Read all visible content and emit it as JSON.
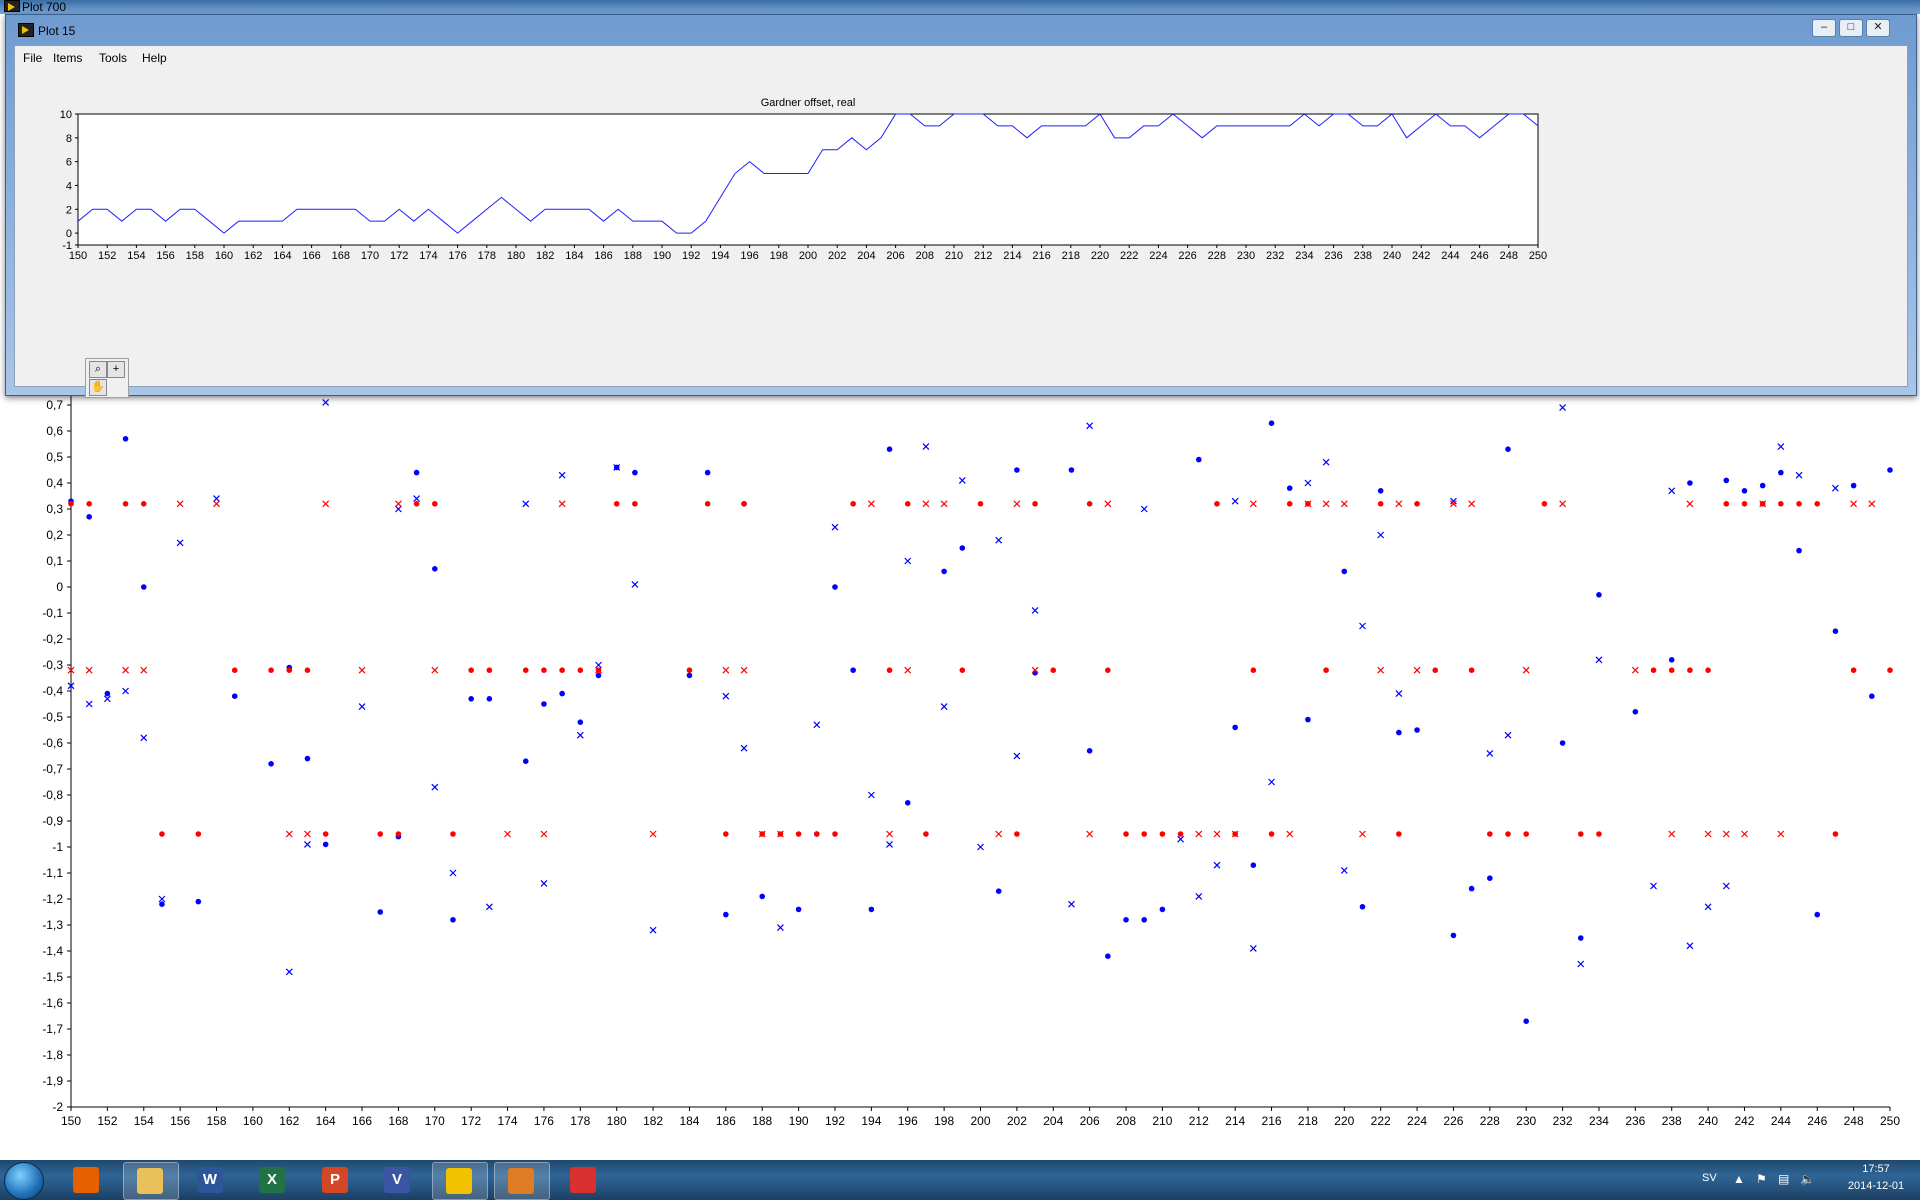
{
  "background_window": {
    "title": "Plot 700"
  },
  "foreground_window": {
    "title": "Plot 15",
    "menu": [
      "File",
      "Items",
      "Tools",
      "Help"
    ],
    "controls": [
      "minimize",
      "maximize",
      "close"
    ]
  },
  "colors": {
    "line": "#1f1fff",
    "blue_series": "#0000ff",
    "red_series": "#ff0000",
    "window_bg": "#f0f0f0",
    "taskbar": "#2f6596"
  },
  "chart_data": [
    {
      "type": "line",
      "title": "Gardner offset, real",
      "xlim": [
        150,
        250
      ],
      "ylim": [
        -1,
        10
      ],
      "xticks": [
        150,
        152,
        154,
        156,
        158,
        160,
        162,
        164,
        166,
        168,
        170,
        172,
        174,
        176,
        178,
        180,
        182,
        184,
        186,
        188,
        190,
        192,
        194,
        196,
        198,
        200,
        202,
        204,
        206,
        208,
        210,
        212,
        214,
        216,
        218,
        220,
        222,
        224,
        226,
        228,
        230,
        232,
        234,
        236,
        238,
        240,
        242,
        244,
        246,
        248,
        250
      ],
      "yticks": [
        -1,
        0,
        2,
        4,
        6,
        8,
        10
      ],
      "grid": false,
      "x": [
        150,
        151,
        152,
        153,
        154,
        155,
        156,
        157,
        158,
        159,
        160,
        161,
        162,
        163,
        164,
        165,
        166,
        167,
        168,
        169,
        170,
        171,
        172,
        173,
        174,
        175,
        176,
        177,
        178,
        179,
        180,
        181,
        182,
        183,
        184,
        185,
        186,
        187,
        188,
        189,
        190,
        191,
        192,
        193,
        194,
        195,
        196,
        197,
        198,
        199,
        200,
        201,
        202,
        203,
        204,
        205,
        206,
        207,
        208,
        209,
        210,
        211,
        212,
        213,
        214,
        215,
        216,
        217,
        218,
        219,
        220,
        221,
        222,
        223,
        224,
        225,
        226,
        227,
        228,
        229,
        230,
        231,
        232,
        233,
        234,
        235,
        236,
        237,
        238,
        239,
        240,
        241,
        242,
        243,
        244,
        245,
        246,
        247,
        248,
        249,
        250
      ],
      "y": [
        1,
        2,
        2,
        1,
        2,
        2,
        1,
        2,
        2,
        1,
        0,
        1,
        1,
        1,
        1,
        2,
        2,
        2,
        2,
        2,
        1,
        1,
        2,
        1,
        2,
        1,
        0,
        1,
        2,
        3,
        2,
        1,
        2,
        2,
        2,
        2,
        1,
        2,
        1,
        1,
        1,
        0,
        0,
        1,
        3,
        5,
        6,
        5,
        5,
        5,
        5,
        7,
        7,
        8,
        7,
        8,
        10,
        10,
        9,
        9,
        10,
        10,
        10,
        9,
        9,
        8,
        9,
        9,
        9,
        9,
        10,
        8,
        8,
        9,
        9,
        10,
        9,
        8,
        9,
        9,
        9,
        9,
        9,
        9,
        10,
        9,
        10,
        10,
        9,
        9,
        10,
        8,
        9,
        10,
        9,
        9,
        8,
        9,
        10,
        10,
        9
      ]
    },
    {
      "type": "scatter",
      "title": "",
      "xlim": [
        150,
        250
      ],
      "ylim": [
        -2,
        0.7
      ],
      "xticks": [
        150,
        152,
        154,
        156,
        158,
        160,
        162,
        164,
        166,
        168,
        170,
        172,
        174,
        176,
        178,
        180,
        182,
        184,
        186,
        188,
        190,
        192,
        194,
        196,
        198,
        200,
        202,
        204,
        206,
        208,
        210,
        212,
        214,
        216,
        218,
        220,
        222,
        224,
        226,
        228,
        230,
        232,
        234,
        236,
        238,
        240,
        242,
        244,
        246,
        248,
        250
      ],
      "yticks": [
        "0,7",
        "0,6",
        "0,5",
        "0,4",
        "0,3",
        "0,2",
        "0,1",
        "0",
        "-0,1",
        "-0,2",
        "-0,3",
        "-0,4",
        "-0,5",
        "-0,6",
        "-0,7",
        "-0,8",
        "-0,9",
        "-1",
        "-1,1",
        "-1,2",
        "-1,3",
        "-1,4",
        "-1,5",
        "-1,6",
        "-1,7",
        "-1,8",
        "-1,9",
        "-2"
      ],
      "grid": false,
      "series": [
        {
          "marker": "dot",
          "color": "#0000ff",
          "x": [
            150,
            151,
            152,
            153,
            154,
            155,
            157,
            159,
            161,
            162,
            163,
            164,
            167,
            168,
            169,
            170,
            171,
            172,
            173,
            175,
            176,
            177,
            178,
            179,
            180,
            181,
            184,
            185,
            186,
            187,
            188,
            190,
            191,
            192,
            193,
            194,
            195,
            196,
            198,
            199,
            201,
            202,
            203,
            205,
            206,
            207,
            208,
            209,
            210,
            212,
            214,
            215,
            216,
            217,
            218,
            220,
            221,
            222,
            223,
            224,
            226,
            227,
            228,
            229,
            230,
            232,
            233,
            234,
            236,
            238,
            239,
            241,
            242,
            243,
            244,
            245,
            246,
            247,
            248,
            249,
            250
          ],
          "y": [
            0.33,
            0.27,
            -0.41,
            0.57,
            0.0,
            -1.22,
            -1.21,
            -0.42,
            -0.68,
            -0.31,
            -0.66,
            -0.99,
            -1.25,
            -0.96,
            0.44,
            0.07,
            -1.28,
            -0.43,
            -0.43,
            -0.67,
            -0.45,
            -0.41,
            -0.52,
            -0.34,
            0.46,
            0.44,
            -0.34,
            0.44,
            -1.26,
            0.32,
            -1.19,
            -1.24,
            -0.95,
            0.0,
            -0.32,
            -1.24,
            0.53,
            -0.83,
            0.06,
            0.15,
            -1.17,
            0.45,
            -0.33,
            0.45,
            -0.63,
            -1.42,
            -1.28,
            -1.28,
            -1.24,
            0.49,
            -0.54,
            -1.07,
            0.63,
            0.38,
            -0.51,
            0.06,
            -1.23,
            0.37,
            -0.56,
            -0.55,
            -1.34,
            -1.16,
            -1.12,
            0.53,
            -1.67,
            -0.6,
            -1.35,
            -0.03,
            -0.48,
            -0.28,
            0.4,
            0.41,
            0.37,
            0.39,
            0.44,
            0.14,
            -1.26,
            -0.17,
            0.39,
            -0.42,
            0.45
          ]
        },
        {
          "marker": "x",
          "color": "#0000ff",
          "x": [
            150,
            151,
            152,
            153,
            154,
            155,
            156,
            158,
            162,
            163,
            164,
            166,
            168,
            169,
            170,
            171,
            173,
            175,
            176,
            177,
            178,
            179,
            180,
            181,
            182,
            186,
            187,
            189,
            191,
            192,
            194,
            195,
            196,
            197,
            198,
            199,
            200,
            201,
            202,
            203,
            205,
            206,
            209,
            211,
            212,
            213,
            214,
            215,
            216,
            218,
            219,
            220,
            221,
            222,
            223,
            226,
            228,
            229,
            232,
            233,
            234,
            237,
            238,
            239,
            240,
            241,
            244,
            245,
            247
          ],
          "y": [
            -0.38,
            -0.45,
            -0.43,
            -0.4,
            -0.58,
            -1.2,
            0.17,
            0.34,
            -1.48,
            -0.99,
            0.71,
            -0.46,
            0.3,
            0.34,
            -0.77,
            -1.1,
            -1.23,
            0.32,
            -1.14,
            0.43,
            -0.57,
            -0.3,
            0.46,
            0.01,
            -1.32,
            -0.42,
            -0.62,
            -1.31,
            -0.53,
            0.23,
            -0.8,
            -0.99,
            0.1,
            0.54,
            -0.46,
            0.41,
            -1.0,
            0.18,
            -0.65,
            -0.09,
            -1.22,
            0.62,
            0.3,
            -0.97,
            -1.19,
            -1.07,
            0.33,
            -1.39,
            -0.75,
            0.4,
            0.48,
            -1.09,
            -0.15,
            0.2,
            -0.41,
            0.33,
            -0.64,
            -0.57,
            0.69,
            -1.45,
            -0.28,
            -1.15,
            0.37,
            -1.38,
            -1.23,
            -1.15,
            0.54,
            0.43,
            0.38
          ]
        },
        {
          "marker": "dot",
          "color": "#ff0000",
          "x": [
            150,
            151,
            153,
            154,
            155,
            157,
            159,
            161,
            162,
            163,
            164,
            167,
            168,
            169,
            170,
            171,
            172,
            173,
            175,
            176,
            177,
            178,
            179,
            180,
            181,
            184,
            185,
            186,
            187,
            188,
            189,
            190,
            191,
            192,
            193,
            195,
            196,
            197,
            199,
            200,
            202,
            203,
            204,
            206,
            207,
            208,
            209,
            210,
            211,
            213,
            214,
            215,
            216,
            217,
            218,
            219,
            222,
            223,
            224,
            225,
            227,
            228,
            229,
            230,
            231,
            233,
            234,
            237,
            238,
            239,
            240,
            241,
            242,
            243,
            244,
            245,
            246,
            247,
            248,
            250
          ],
          "y": [
            0.32,
            0.32,
            0.32,
            0.32,
            -0.95,
            -0.95,
            -0.32,
            -0.32,
            -0.32,
            -0.32,
            -0.95,
            -0.95,
            -0.95,
            0.32,
            0.32,
            -0.95,
            -0.32,
            -0.32,
            -0.32,
            -0.32,
            -0.32,
            -0.32,
            -0.32,
            0.32,
            0.32,
            -0.32,
            0.32,
            -0.95,
            0.32,
            -0.95,
            -0.95,
            -0.95,
            -0.95,
            -0.95,
            0.32,
            -0.32,
            0.32,
            -0.95,
            -0.32,
            0.32,
            -0.95,
            0.32,
            -0.32,
            0.32,
            -0.32,
            -0.95,
            -0.95,
            -0.95,
            -0.95,
            0.32,
            -0.95,
            -0.32,
            -0.95,
            0.32,
            0.32,
            -0.32,
            0.32,
            -0.95,
            0.32,
            -0.32,
            -0.32,
            -0.95,
            -0.95,
            -0.95,
            0.32,
            -0.95,
            -0.95,
            -0.32,
            -0.32,
            -0.32,
            -0.32,
            0.32,
            0.32,
            0.32,
            0.32,
            0.32,
            0.32,
            -0.95,
            -0.32,
            -0.32
          ]
        },
        {
          "marker": "x",
          "color": "#ff0000",
          "x": [
            150,
            151,
            153,
            154,
            156,
            158,
            162,
            163,
            164,
            166,
            168,
            170,
            174,
            176,
            177,
            179,
            182,
            186,
            187,
            188,
            189,
            194,
            195,
            196,
            197,
            198,
            201,
            202,
            203,
            206,
            207,
            212,
            213,
            214,
            215,
            217,
            218,
            219,
            220,
            221,
            222,
            223,
            224,
            226,
            227,
            230,
            232,
            236,
            238,
            239,
            240,
            241,
            242,
            243,
            244,
            248,
            249
          ],
          "y": [
            -0.32,
            -0.32,
            -0.32,
            -0.32,
            0.32,
            0.32,
            -0.95,
            -0.95,
            0.32,
            -0.32,
            0.32,
            -0.32,
            -0.95,
            -0.95,
            0.32,
            -0.32,
            -0.95,
            -0.32,
            -0.32,
            -0.95,
            -0.95,
            0.32,
            -0.95,
            -0.32,
            0.32,
            0.32,
            -0.95,
            0.32,
            -0.32,
            -0.95,
            0.32,
            -0.95,
            -0.95,
            -0.95,
            0.32,
            -0.95,
            0.32,
            0.32,
            0.32,
            -0.95,
            -0.32,
            0.32,
            -0.32,
            0.32,
            0.32,
            -0.32,
            0.32,
            -0.32,
            -0.95,
            0.32,
            -0.95,
            -0.95,
            -0.95,
            0.32,
            -0.95,
            0.32,
            0.32
          ]
        }
      ]
    }
  ],
  "taskbar": {
    "items": [
      {
        "name": "firefox",
        "glyph": "",
        "color": "#e66000"
      },
      {
        "name": "windows-explorer",
        "glyph": "",
        "color": "#e8c15a"
      },
      {
        "name": "word",
        "glyph": "W",
        "color": "#2b579a"
      },
      {
        "name": "excel",
        "glyph": "X",
        "color": "#217346"
      },
      {
        "name": "powerpoint",
        "glyph": "P",
        "color": "#d24726"
      },
      {
        "name": "visio",
        "glyph": "V",
        "color": "#3955a3"
      },
      {
        "name": "labview",
        "glyph": "",
        "color": "#f2c200"
      },
      {
        "name": "matlab",
        "glyph": "",
        "color": "#e07b25"
      },
      {
        "name": "app",
        "glyph": "",
        "color": "#d93030"
      }
    ],
    "tray": {
      "language": "SV",
      "time": "17:57",
      "date": "2014-12-01"
    }
  }
}
